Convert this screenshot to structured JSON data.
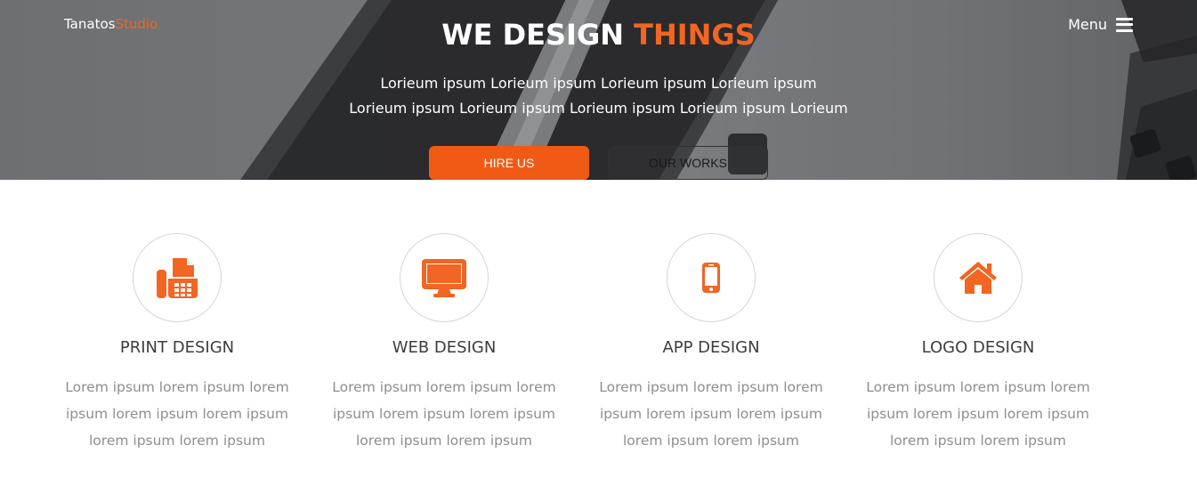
{
  "brand": {
    "name": "Tanatos",
    "accent": "Studio"
  },
  "nav": {
    "menu_label": "Menu"
  },
  "hero": {
    "title_main": "WE DESIGN ",
    "title_accent": "THINGS",
    "text_lines": [
      "Lorieum ipsum Lorieum ipsum Lorieum ipsum Lorieum ipsum",
      "Lorieum ipsum Lorieum ipsum Lorieum ipsum Lorieum ipsum Lorieum"
    ],
    "hire_label": "HIRE US",
    "works_label": "OUR WORKS"
  },
  "services": [
    {
      "icon": "fax-icon",
      "title": "PRINT DESIGN",
      "lines": [
        "Lorem ipsum lorem ipsum lorem",
        "ipsum lorem ipsum lorem ipsum",
        "lorem ipsum lorem ipsum"
      ]
    },
    {
      "icon": "desktop-icon",
      "title": "WEB DESIGN",
      "lines": [
        "Lorem ipsum lorem ipsum lorem",
        "ipsum lorem ipsum lorem ipsum",
        "lorem ipsum lorem ipsum"
      ]
    },
    {
      "icon": "mobile-phone-icon",
      "title": "APP DESIGN",
      "lines": [
        "Lorem ipsum lorem ipsum lorem",
        "ipsum lorem ipsum lorem ipsum",
        "lorem ipsum lorem ipsum"
      ]
    },
    {
      "icon": "home-icon",
      "title": "LOGO DESIGN",
      "lines": [
        "Lorem ipsum lorem ipsum lorem",
        "ipsum lorem ipsum lorem ipsum",
        "lorem ipsum lorem ipsum"
      ]
    }
  ],
  "colors": {
    "accent": "#f26522",
    "hire_button": "#f15a14",
    "service_title": "#3d3d3d",
    "service_text": "#8e8e8e"
  }
}
